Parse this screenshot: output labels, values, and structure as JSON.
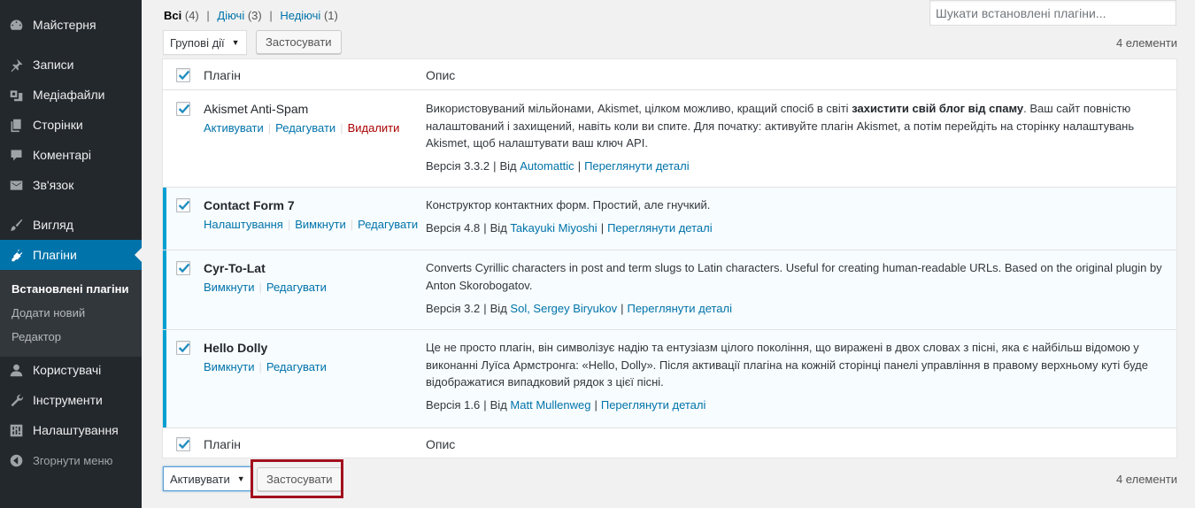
{
  "sidebar": {
    "items": [
      {
        "label": "Майстерня",
        "icon": "dashboard-icon"
      },
      {
        "label": "Записи",
        "icon": "pin-icon"
      },
      {
        "label": "Медіафайли",
        "icon": "media-icon"
      },
      {
        "label": "Сторінки",
        "icon": "pages-icon"
      },
      {
        "label": "Коментарі",
        "icon": "comment-icon"
      },
      {
        "label": "Зв'язок",
        "icon": "envelope-icon"
      },
      {
        "label": "Вигляд",
        "icon": "brush-icon"
      },
      {
        "label": "Плагіни",
        "icon": "plugin-icon"
      },
      {
        "label": "Користувачі",
        "icon": "user-icon"
      },
      {
        "label": "Інструменти",
        "icon": "wrench-icon"
      },
      {
        "label": "Налаштування",
        "icon": "settings-icon"
      },
      {
        "label": "Згорнути меню",
        "icon": "collapse-icon"
      }
    ],
    "submenu": [
      "Встановлені плагіни",
      "Додати новий",
      "Редактор"
    ]
  },
  "filters": {
    "all": "Всі",
    "all_count": "(4)",
    "active": "Діючі",
    "active_count": "(3)",
    "inactive": "Недіючі",
    "inactive_count": "(1)",
    "separator": "|"
  },
  "search": {
    "placeholder": "Шукати встановлені плагіни..."
  },
  "top_nav": {
    "bulk_action": "Групові дії",
    "apply": "Застосувати",
    "count": "4 елементи"
  },
  "bottom_nav": {
    "bulk_action": "Активувати",
    "apply": "Застосувати",
    "count": "4 елементи"
  },
  "table": {
    "col_plugin": "Плагін",
    "col_desc": "Опис",
    "plugins": [
      {
        "name": "Akismet Anti-Spam",
        "actions": [
          "Активувати",
          "Редагувати",
          "Видалити"
        ],
        "desc_before": "Використовуваний мільйонами, Akismet, цілком можливо, кращий спосіб в світі ",
        "desc_bold": "захистити свій блог від спаму",
        "desc_after": ". Ваш сайт повністю налаштований і захищений, навіть коли ви спите. Для початку: активуйте плагін Akismet, а потім перейдіть на сторінку налаштувань Akismet, щоб налаштувати ваш ключ API.",
        "version": "Версія 3.3.2",
        "by": "Від",
        "author": "Automattic",
        "details": "Переглянути деталі"
      },
      {
        "name": "Contact Form 7",
        "actions": [
          "Налаштування",
          "Вимкнути",
          "Редагувати"
        ],
        "desc": "Конструктор контактних форм. Простий, але гнучкий.",
        "version": "Версія 4.8",
        "by": "Від",
        "author": "Takayuki Miyoshi",
        "details": "Переглянути деталі"
      },
      {
        "name": "Cyr-To-Lat",
        "actions": [
          "Вимкнути",
          "Редагувати"
        ],
        "desc": "Converts Cyrillic characters in post and term slugs to Latin characters. Useful for creating human-readable URLs. Based on the original plugin by Anton Skorobogatov.",
        "version": "Версія 3.2",
        "by": "Від",
        "author": "Sol, Sergey Biryukov",
        "details": "Переглянути деталі"
      },
      {
        "name": "Hello Dolly",
        "actions": [
          "Вимкнути",
          "Редагувати"
        ],
        "desc": "Це не просто плагін, він символізує надію та ентузіазм цілого покоління, що виражені в двох словах з пісні, яка є найбільш відомою у виконанні Луїса Армстронга: «Hello, Dolly». Після активації плагіна на кожній сторінці панелі управління в правому верхньому куті буде відображатися випадковий рядок з цієї пісні.",
        "version": "Версія 1.6",
        "by": "Від",
        "author": "Matt Mullenweg",
        "details": "Переглянути деталі"
      }
    ]
  },
  "colors": {
    "accent": "#0073aa",
    "sidebar_bg": "#23282d",
    "active_border": "#00a0d2",
    "highlight": "#a30f1d",
    "delete": "#aa0000"
  }
}
